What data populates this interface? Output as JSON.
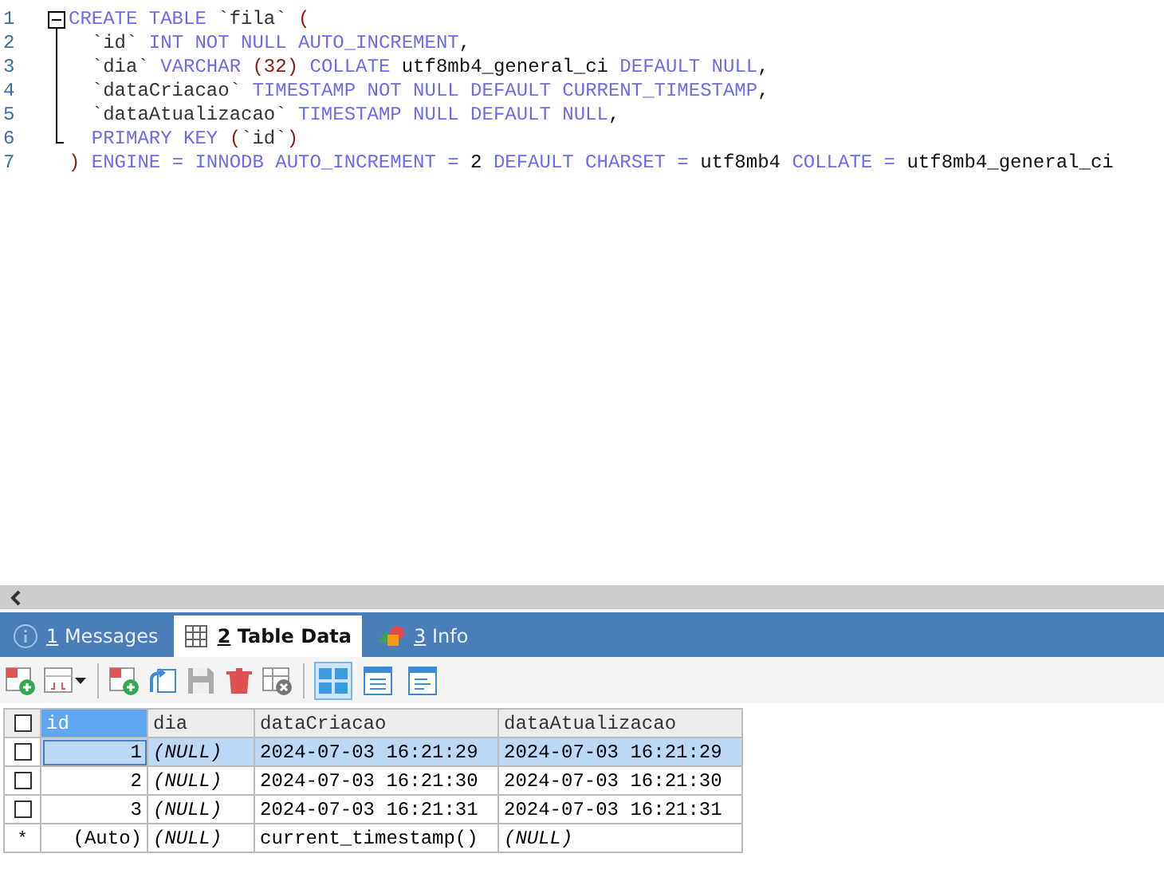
{
  "editor": {
    "lines": [
      {
        "number": "1",
        "kind": "fold-start",
        "tokens": [
          {
            "kind": "keyword",
            "text": "CREATE TABLE "
          },
          {
            "kind": "identifier",
            "text": "`fila`"
          },
          {
            "kind": "punct",
            "text": " ("
          }
        ]
      },
      {
        "number": "2",
        "kind": "fold-inner",
        "tokens": [
          {
            "kind": "identifier",
            "text": "  `id`"
          },
          {
            "kind": "keyword",
            "text": " INT NOT NULL AUTO_INCREMENT"
          },
          {
            "kind": "plain",
            "text": ","
          }
        ]
      },
      {
        "number": "3",
        "kind": "fold-inner",
        "tokens": [
          {
            "kind": "identifier",
            "text": "  `dia`"
          },
          {
            "kind": "keyword",
            "text": " VARCHAR "
          },
          {
            "kind": "punct",
            "text": "(32)"
          },
          {
            "kind": "keyword",
            "text": " COLLATE "
          },
          {
            "kind": "plain",
            "text": "utf8mb4_general_ci"
          },
          {
            "kind": "keyword",
            "text": " DEFAULT NULL"
          },
          {
            "kind": "plain",
            "text": ","
          }
        ]
      },
      {
        "number": "4",
        "kind": "fold-inner",
        "tokens": [
          {
            "kind": "identifier",
            "text": "  `dataCriacao`"
          },
          {
            "kind": "keyword",
            "text": " TIMESTAMP NOT NULL DEFAULT CURRENT_TIMESTAMP"
          },
          {
            "kind": "plain",
            "text": ","
          }
        ]
      },
      {
        "number": "5",
        "kind": "fold-inner",
        "tokens": [
          {
            "kind": "identifier",
            "text": "  `dataAtualizacao`"
          },
          {
            "kind": "keyword",
            "text": " TIMESTAMP NULL DEFAULT NULL"
          },
          {
            "kind": "plain",
            "text": ","
          }
        ]
      },
      {
        "number": "6",
        "kind": "fold-end",
        "tokens": [
          {
            "kind": "keyword",
            "text": "  PRIMARY KEY "
          },
          {
            "kind": "punct",
            "text": "("
          },
          {
            "kind": "identifier",
            "text": "`id`"
          },
          {
            "kind": "punct",
            "text": ")"
          }
        ]
      },
      {
        "number": "7",
        "kind": "plain",
        "tokens": [
          {
            "kind": "punct",
            "text": ")"
          },
          {
            "kind": "keyword",
            "text": " ENGINE = INNODB AUTO_INCREMENT = "
          },
          {
            "kind": "plain",
            "text": "2"
          },
          {
            "kind": "keyword",
            "text": " DEFAULT CHARSET = "
          },
          {
            "kind": "plain",
            "text": "utf8mb4"
          },
          {
            "kind": "keyword",
            "text": " COLLATE = "
          },
          {
            "kind": "plain",
            "text": "utf8mb4_general_ci"
          }
        ]
      }
    ]
  },
  "tabs": [
    {
      "key": "1",
      "label": "Messages",
      "kind": "info",
      "selected": false
    },
    {
      "key": "2",
      "label": "Table Data",
      "kind": "table",
      "selected": true
    },
    {
      "key": "3",
      "label": "Info",
      "kind": "shapes",
      "selected": false
    }
  ],
  "view_buttons": [
    {
      "kind": "grid",
      "selected": true
    },
    {
      "kind": "form",
      "selected": false
    },
    {
      "kind": "text",
      "selected": false
    }
  ],
  "table": {
    "header_checked": false,
    "columns": [
      {
        "name": "id",
        "selected": true
      },
      {
        "name": "dia",
        "selected": false
      },
      {
        "name": "dataCriacao",
        "selected": false
      },
      {
        "name": "dataAtualizacao",
        "selected": false
      }
    ],
    "rows": [
      {
        "kind": "data",
        "selected": true,
        "checked": false,
        "cells": [
          {
            "text": "1",
            "kind": "number"
          },
          {
            "text": "(NULL)",
            "kind": "null"
          },
          {
            "text": "2024-07-03 16:21:29",
            "kind": "text"
          },
          {
            "text": "2024-07-03 16:21:29",
            "kind": "text"
          }
        ]
      },
      {
        "kind": "data",
        "selected": false,
        "checked": false,
        "cells": [
          {
            "text": "2",
            "kind": "number"
          },
          {
            "text": "(NULL)",
            "kind": "null"
          },
          {
            "text": "2024-07-03 16:21:30",
            "kind": "text"
          },
          {
            "text": "2024-07-03 16:21:30",
            "kind": "text"
          }
        ]
      },
      {
        "kind": "data",
        "selected": false,
        "checked": false,
        "cells": [
          {
            "text": "3",
            "kind": "number"
          },
          {
            "text": "(NULL)",
            "kind": "null"
          },
          {
            "text": "2024-07-03 16:21:31",
            "kind": "text"
          },
          {
            "text": "2024-07-03 16:21:31",
            "kind": "text"
          }
        ]
      },
      {
        "kind": "new",
        "marker": "*",
        "selected": false,
        "cells": [
          {
            "text": "(Auto)",
            "kind": "number"
          },
          {
            "text": "(NULL)",
            "kind": "null"
          },
          {
            "text": "current_timestamp()",
            "kind": "text"
          },
          {
            "text": "(NULL)",
            "kind": "null"
          }
        ]
      }
    ]
  }
}
